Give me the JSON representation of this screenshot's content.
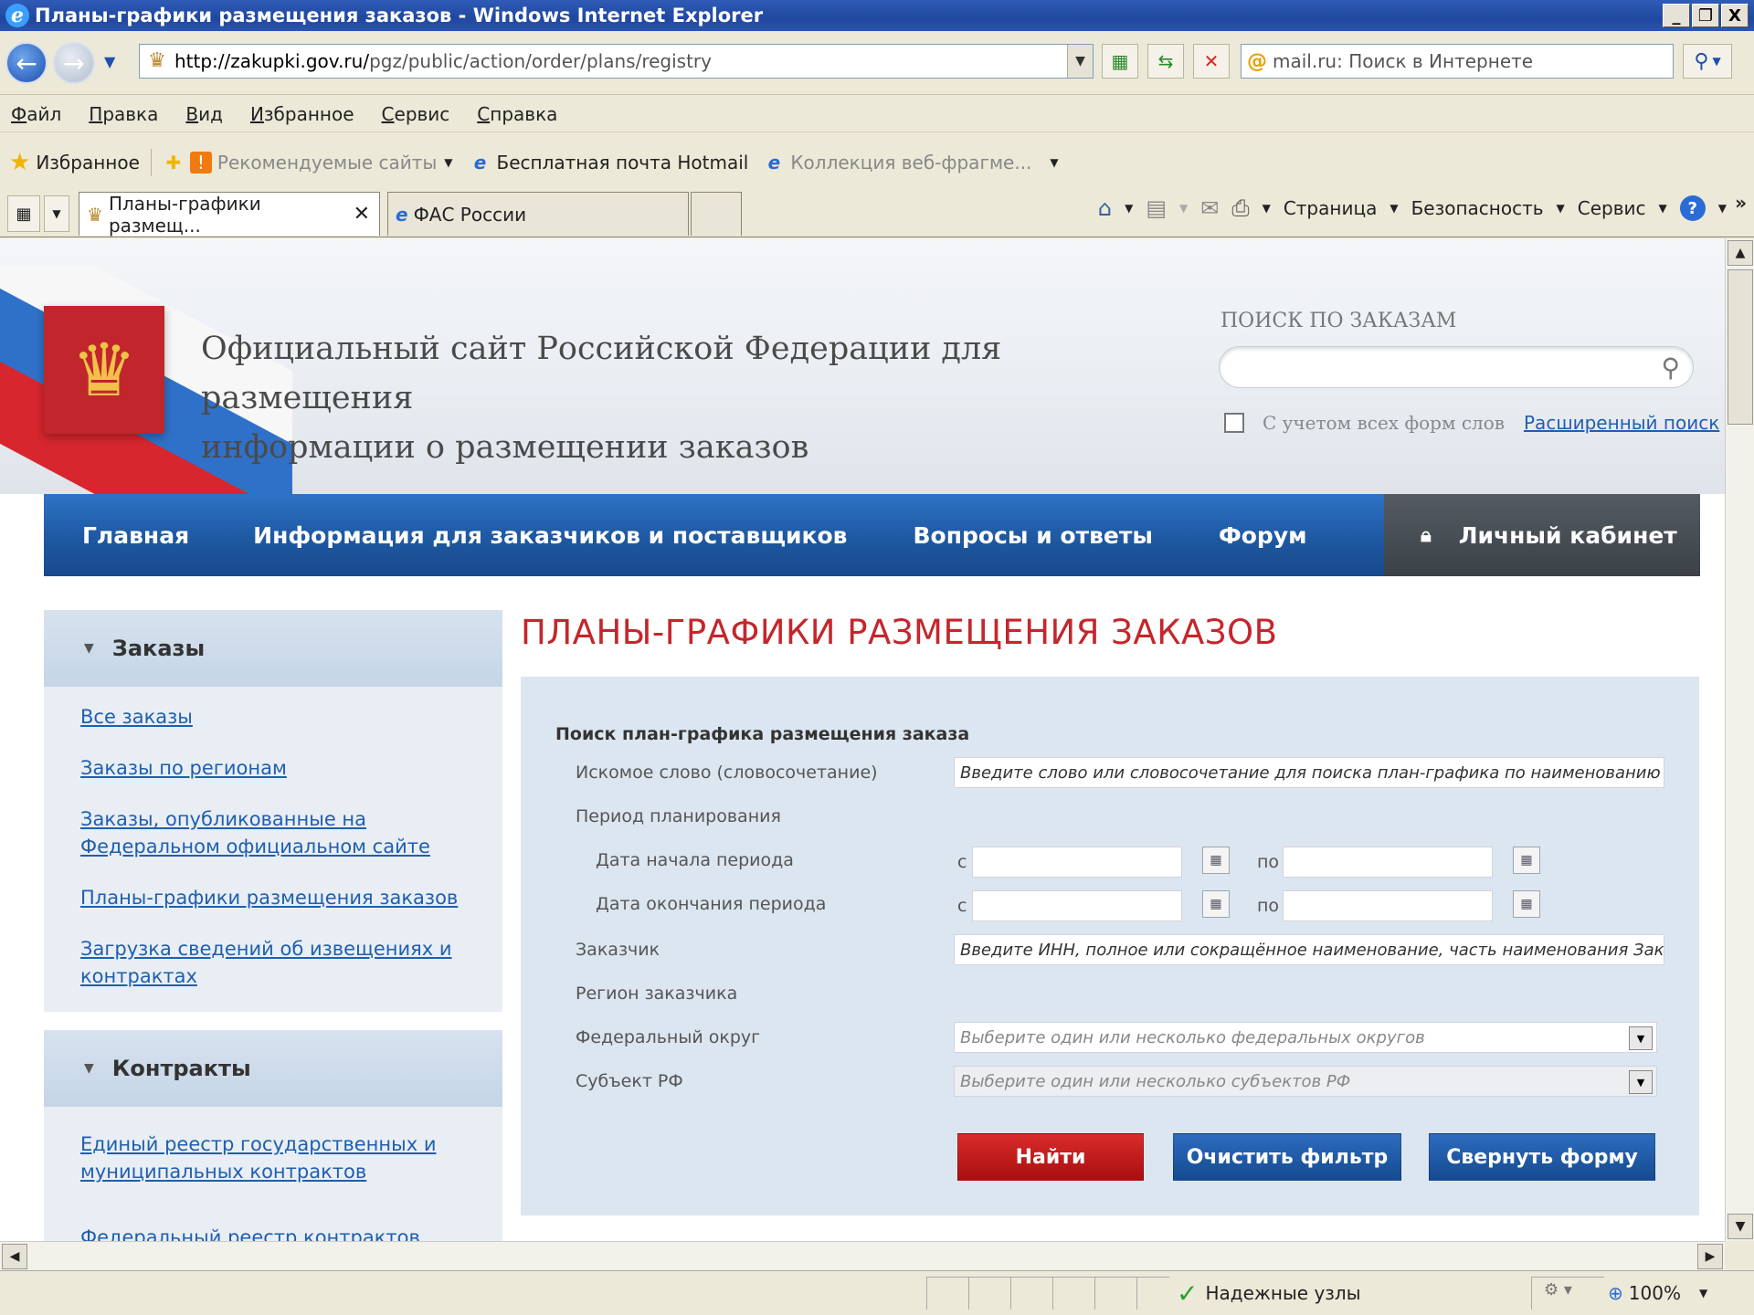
{
  "window": {
    "title": "Планы-графики размещения заказов - Windows Internet Explorer",
    "min": "_",
    "max": "❐",
    "close": "X"
  },
  "address": {
    "url_host": "http://zakupki.gov.ru/",
    "url_path": "pgz/public/action/order/plans/registry",
    "search_placeholder": "mail.ru: Поиск в Интернете"
  },
  "menu": [
    "Файл",
    "Правка",
    "Вид",
    "Избранное",
    "Сервис",
    "Справка"
  ],
  "favorites": {
    "label": "Избранное",
    "items": [
      "Рекомендуемые сайты",
      "Бесплатная почта Hotmail",
      "Коллекция веб-фрагме..."
    ]
  },
  "tabs": [
    {
      "label": "Планы-графики размещ..."
    },
    {
      "label": "ФАС России"
    }
  ],
  "commands": [
    "Страница",
    "Безопасность",
    "Сервис"
  ],
  "site": {
    "title_line1": "Официальный сайт Российской Федерации для размещения",
    "title_line2": "информации о размещении заказов",
    "search_label": "ПОИСК ПО ЗАКАЗАМ",
    "wordforms": "С учетом всех форм слов",
    "advanced": "Расширенный поиск"
  },
  "nav": {
    "items": [
      "Главная",
      "Информация для заказчиков и поставщиков",
      "Вопросы и ответы",
      "Форум"
    ],
    "cabinet": "Личный кабинет"
  },
  "sidebar": {
    "orders_head": "Заказы",
    "orders_links": [
      "Все заказы",
      "Заказы по регионам",
      "Заказы, опубликованные на Федеральном официальном сайте",
      "Планы-графики размещения заказов",
      "Загрузка сведений об извещениях и контрактах"
    ],
    "contracts_head": "Контракты",
    "contracts_links": [
      "Единый реестр государственных и муниципальных контрактов",
      "Федеральный реестр контрактов"
    ]
  },
  "form": {
    "heading": "ПЛАНЫ-ГРАФИКИ РАЗМЕЩЕНИЯ ЗАКАЗОВ",
    "title": "Поиск план-графика размещения заказа",
    "keyword_label": "Искомое слово (словосочетание)",
    "keyword_placeholder": "Введите слово или словосочетание для поиска план-графика по наименованию",
    "period_label": "Период планирования",
    "start_label": "Дата начала периода",
    "end_label": "Дата окончания периода",
    "from": "с",
    "to": "по",
    "customer_label": "Заказчик",
    "customer_placeholder": "Введите ИНН, полное или сокращённое наименование, часть наименования Зак",
    "region_label": "Регион заказчика",
    "district_label": "Федеральный округ",
    "district_placeholder": "Выберите один или несколько федеральных округов",
    "subject_label": "Субъект РФ",
    "subject_placeholder": "Выберите один или несколько субъектов РФ",
    "btn_find": "Найти",
    "btn_clear": "Очистить фильтр",
    "btn_collapse": "Свернуть форму"
  },
  "status": {
    "zone": "Надежные узлы",
    "zoom": "100%"
  }
}
